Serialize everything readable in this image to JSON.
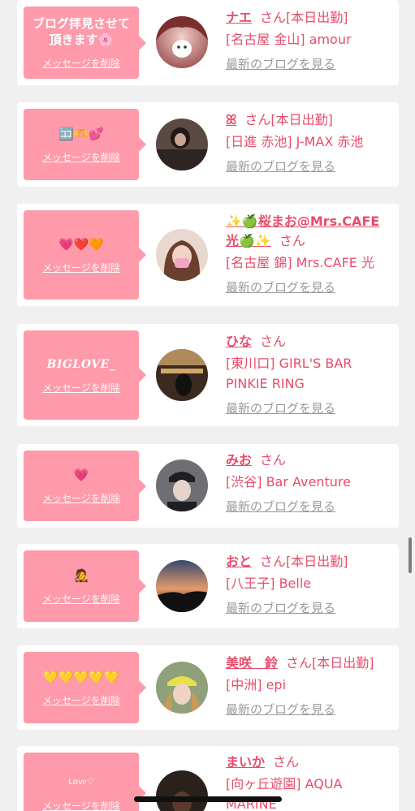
{
  "common": {
    "san": "さん",
    "delete_label": "メッセージを削除",
    "blog_label": "最新のブログを見る"
  },
  "items": [
    {
      "message": "ブログ拝見させて頂きます🌸",
      "name": "ナエ",
      "status": "[本日出勤]",
      "shop": "[名古屋 金山] amour"
    },
    {
      "message": "🈁🫶💕",
      "name": "ꕤ",
      "status": "[本日出勤]",
      "shop": "[日進 赤池] J-MAX 赤池"
    },
    {
      "message": "💗❤️🧡",
      "name": "✨🍏桜まお@Mrs.CAFE光🍏✨",
      "status": "",
      "shop": "[名古屋 錦] Mrs.CAFE 光"
    },
    {
      "message": "BIGLOVE_",
      "name": "ひな",
      "status": "",
      "shop": "[東川口] GIRL'S BAR PINKIE RING"
    },
    {
      "message": "💗",
      "name": "みお",
      "status": "",
      "shop": "[渋谷] Bar Aventure"
    },
    {
      "message": "🧑‍🎤",
      "name": "おと",
      "status": "[本日出勤]",
      "shop": "[八王子] Belle"
    },
    {
      "message": "💛💛💛💛💛",
      "name": "美咲　鈴",
      "status": "[本日出勤]",
      "shop": "[中洲] epi"
    },
    {
      "message": "ᒪovᥱ♡",
      "name": "まいか",
      "status": "",
      "shop": "[向ヶ丘遊園] AQUA MARINE"
    }
  ]
}
